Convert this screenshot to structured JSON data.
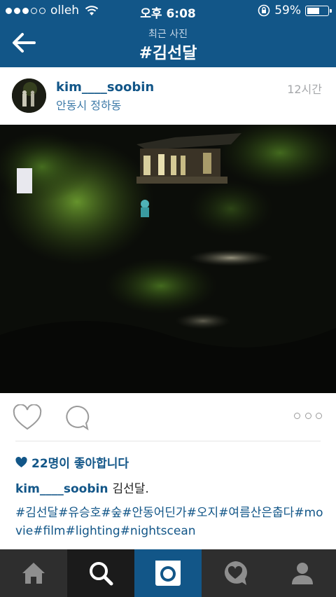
{
  "status_bar": {
    "carrier": "olleh",
    "time": "오후 6:08",
    "battery": "59%",
    "battery_level": 0.59
  },
  "nav": {
    "subtitle": "최근 사진",
    "title": "#김선달"
  },
  "post": {
    "username": "kim____soobin",
    "location": "안동시 정하동",
    "time_ago": "12시간",
    "likes": "22명이 좋아합니다",
    "caption_user": "kim____soobin",
    "caption_text": "김선달.",
    "tags": "#김선달#유승호#숲#안동어딘가#오지#여름산은춥다#movie#film#lighting#nightscean"
  },
  "colors": {
    "brand": "#125688",
    "tabbar": "#2a2a2a"
  },
  "icons": {
    "back": "arrow-left-icon",
    "like": "heart-outline-icon",
    "comment": "speech-bubble-icon",
    "more": "ellipsis-icon",
    "tabs": [
      "home-icon",
      "search-icon",
      "camera-icon",
      "activity-heart-icon",
      "profile-icon"
    ]
  }
}
